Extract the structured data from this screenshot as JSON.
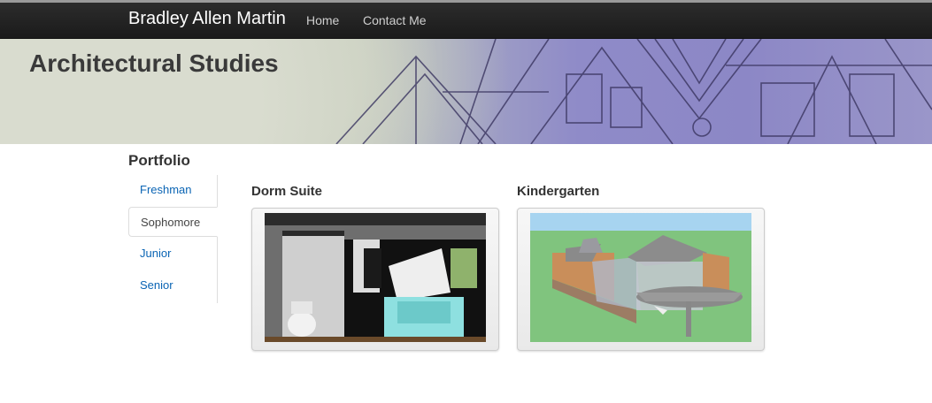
{
  "navbar": {
    "brand": "Bradley Allen Martin",
    "links": [
      "Home",
      "Contact Me"
    ]
  },
  "hero": {
    "title": "Architectural Studies"
  },
  "portfolio": {
    "heading": "Portfolio",
    "items": [
      {
        "label": "Freshman",
        "active": false
      },
      {
        "label": "Sophomore",
        "active": true
      },
      {
        "label": "Junior",
        "active": false
      },
      {
        "label": "Senior",
        "active": false
      }
    ]
  },
  "projects": [
    {
      "title": "Dorm Suite",
      "image": "dorm-suite-render"
    },
    {
      "title": "Kindergarten",
      "image": "kindergarten-render"
    }
  ],
  "colors": {
    "navbar": "#222222",
    "link": "#0a64b4",
    "hero_purple": "#8c87c6"
  }
}
